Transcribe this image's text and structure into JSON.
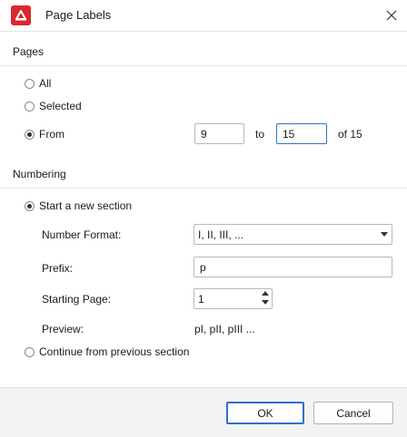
{
  "window": {
    "title": "Page Labels",
    "app_icon": "app-logo-icon",
    "close_icon": "close-icon"
  },
  "pages": {
    "section_title": "Pages",
    "all_label": "All",
    "selected_label": "Selected",
    "from_label": "From",
    "from_value": "9",
    "to_label": "to",
    "to_value": "15",
    "of_label": "of 15",
    "selected_option": "From"
  },
  "numbering": {
    "section_title": "Numbering",
    "new_section_label": "Start a new section",
    "continue_label": "Continue from previous section",
    "selected_option": "Start a new section",
    "number_format_label": "Number Format:",
    "number_format_value": "I, II, III, ...",
    "prefix_label": "Prefix:",
    "prefix_value": "p",
    "starting_page_label": "Starting Page:",
    "starting_page_value": "1",
    "preview_label": "Preview:",
    "preview_value": "pI, pII, pIII ..."
  },
  "footer": {
    "ok_label": "OK",
    "cancel_label": "Cancel"
  },
  "colors": {
    "accent": "#2d6fcf",
    "app_icon_bg": "#d8282f",
    "footer_bg": "#f3f3f3"
  }
}
